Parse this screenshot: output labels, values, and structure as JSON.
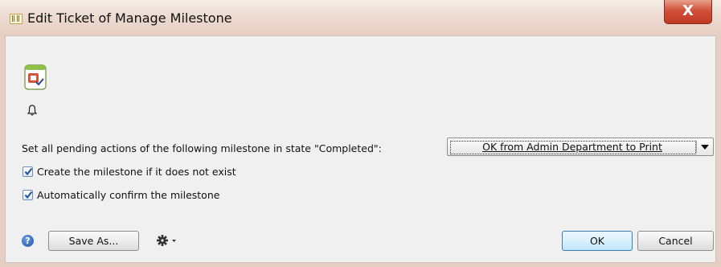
{
  "window": {
    "title": "Edit Ticket of Manage Milestone",
    "close_glyph": "X"
  },
  "icons": {
    "app": "ticket-icon",
    "main": "milestone-calendar-icon",
    "bell": "bell-icon",
    "help": "help-icon",
    "gear": "gear-icon"
  },
  "form": {
    "pending_label": "Set all pending actions of the following milestone in state \"Completed\":",
    "milestone_select": {
      "value": "OK from Admin Department to Print"
    },
    "checkboxes": [
      {
        "label": "Create the milestone if it does not exist",
        "checked": true
      },
      {
        "label": "Automatically confirm the milestone",
        "checked": true
      }
    ]
  },
  "footer": {
    "help_glyph": "?",
    "save_as_label": "Save As...",
    "ok_label": "OK",
    "cancel_label": "Cancel"
  },
  "colors": {
    "titlebar": "#ecd8cf",
    "close": "#c13a25",
    "accent": "#3c7fb1"
  }
}
